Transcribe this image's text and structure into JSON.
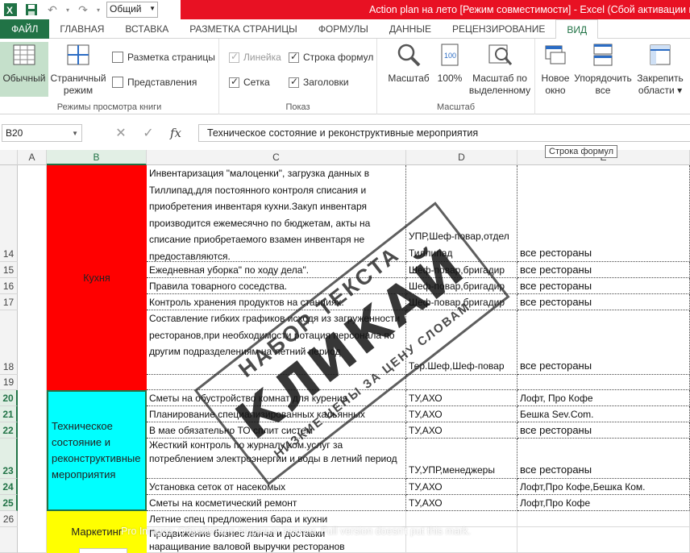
{
  "titlebar": {
    "style_value": "Общий",
    "title": "Action plan на лето  [Режим совместимости] - Excel (Сбой активации пр"
  },
  "tabs": [
    "ГЛАВНАЯ",
    "ВСТАВКА",
    "РАЗМЕТКА СТРАНИЦЫ",
    "ФОРМУЛЫ",
    "ДАННЫЕ",
    "РЕЦЕНЗИРОВАНИЕ",
    "ВИД"
  ],
  "file_tab": "ФАЙЛ",
  "ribbon": {
    "views": {
      "normal": "Обычный",
      "page_layout": [
        "Страничный",
        "режим"
      ],
      "page_markup": "Разметка страницы",
      "custom_views": "Представления",
      "label": "Режимы просмотра книги"
    },
    "show": {
      "ruler": "Линейка",
      "formula_bar": "Строка формул",
      "gridlines": "Сетка",
      "headings": "Заголовки",
      "label": "Показ"
    },
    "zoom": {
      "zoom": "Масштаб",
      "hundred": "100%",
      "zoom_selection": [
        "Масштаб по",
        "выделенному"
      ],
      "label": "Масштаб"
    },
    "window": {
      "new_window": [
        "Новое",
        "окно"
      ],
      "arrange_all": [
        "Упорядочить",
        "все"
      ],
      "freeze_panes": [
        "Закрепить",
        "области ▾"
      ]
    }
  },
  "formula_bar": {
    "name_box": "B20",
    "content": "Техническое состояние и реконструктивные мероприятия",
    "tooltip": "Строка формул"
  },
  "columns": [
    "A",
    "B",
    "C",
    "D",
    "E"
  ],
  "rows": [
    "14",
    "15",
    "16",
    "17",
    "18",
    "19",
    "20",
    "21",
    "22",
    "23",
    "24",
    "25",
    "26"
  ],
  "cells": {
    "b_kitchen": "Кухня",
    "b_tech": "Техническое состояние и реконструктивные мероприятия",
    "b_marketing": "Маркетинг",
    "c14": "Инвентаризация \"малоценки\",  загрузка данных в Тиллипад,для постоянного контроля списания и приобретения инвентаря кухни.Закуп инвентаря производится ежемесячно по бюджетам, акты на списание приобретаемого взамен инвентаря не предоставляются.",
    "d14": "УПР,Шеф-повар,отдел Тиллипад",
    "e14": "все рестораны",
    "c15": "Ежедневная уборка\" по ходу дела\".",
    "d15": "Шеф-повар,бригадир",
    "e15": "все рестораны",
    "c16": "Правила товарного соседства.",
    "d16": "Шеф-повар,бригадир",
    "e16": "все рестораны",
    "c17": "Контроль хранения продуктов на станциях.",
    "d17": "Шеф-повар,бригадир",
    "e17": "все рестораны",
    "c18": "Составление гибких графиков исходя из загруженности ресторанов,при необходимости ротация персонала по другим подразделениям на летний период",
    "d18": "Тер.Шеф,Шеф-повар",
    "e18": "все рестораны",
    "c20": "Сметы на обустройство комнат для курения",
    "d20": "ТУ,АХО",
    "e20": "Лофт, Про Кофе",
    "c21": "Планирование специализированных кальянных",
    "d21": "ТУ,АХО",
    "e21": "Бешка Sev.Com.",
    "c22": "В мае  обязательно  ТО сплит систем",
    "d22": "ТУ,АХО",
    "e22": "все рестораны",
    "c23": "Жесткий контроль по журналу ком.услуг за потреблением электроэнергии и воды в летний период",
    "d23": "ТУ,УПР,менеджеры",
    "e23": "все рестораны",
    "c24": "Установка сеток от насекомых",
    "d24": "ТУ,АХО",
    "e24": "Лофт,Про Кофе,Бешка Ком.",
    "c25": "Сметы на косметический ремонт",
    "d25": "ТУ,АХО",
    "e25": "Лофт,Про Кофе",
    "c26": "Летние спец предложения бара и кухни",
    "c27a": "Продвижение бизнес ланча и доставки",
    "c27b": "наращивание валовой выручки ресторанов"
  },
  "watermark": {
    "line1": "НАБОР ТЕКСТА",
    "line2": "КЛИКАЙ",
    "line3": "НИЗКИЕ ЦЕНЫ ЗА ЦЕНУ СЛОВАМ"
  },
  "trial_banner": "Pro Images: Обработано водяным знаком. Full version doesn't put this mark.",
  "colors": {
    "excel_green": "#217346",
    "title_red": "#e81123",
    "kitchen_fill": "#ff0000",
    "tech_fill": "#00ffff",
    "marketing_fill": "#ffff00"
  }
}
